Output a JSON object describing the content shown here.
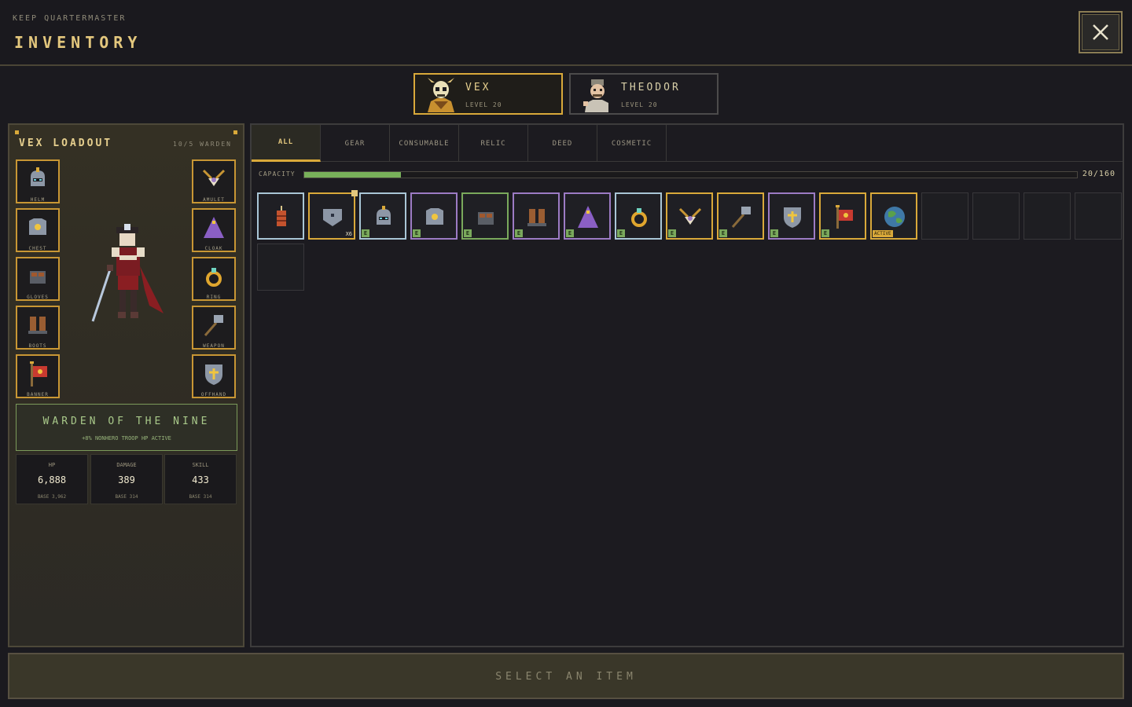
{
  "header": {
    "kicker": "KEEP QUARTERMASTER",
    "title": "INVENTORY",
    "close_icon": "close-icon"
  },
  "heroes": [
    {
      "name": "VEX",
      "level": "LEVEL 20",
      "active": true,
      "portrait": "skull-hero-portrait"
    },
    {
      "name": "THEODOR",
      "level": "LEVEL 20",
      "active": false,
      "portrait": "chef-hero-portrait"
    }
  ],
  "loadout": {
    "title": "VEX LOADOUT",
    "count": "10/5 WARDEN",
    "left_slots": [
      {
        "label": "HELM",
        "icon": "helm-icon"
      },
      {
        "label": "CHEST",
        "icon": "chest-armor-icon"
      },
      {
        "label": "GLOVES",
        "icon": "gloves-icon"
      },
      {
        "label": "BOOTS",
        "icon": "boots-icon"
      },
      {
        "label": "BANNER",
        "icon": "banner-icon"
      }
    ],
    "right_slots": [
      {
        "label": "AMULET",
        "icon": "amulet-icon"
      },
      {
        "label": "CLOAK",
        "icon": "cloak-icon"
      },
      {
        "label": "RING",
        "icon": "ring-icon"
      },
      {
        "label": "WEAPON",
        "icon": "hammer-icon"
      },
      {
        "label": "OFFHAND",
        "icon": "shield-icon"
      }
    ],
    "set": {
      "name": "WARDEN OF THE NINE",
      "bonus": "+8% NONHERO TROOP HP ACTIVE"
    },
    "stats": [
      {
        "label": "HP",
        "value": "6,888",
        "base": "BASE 3,962"
      },
      {
        "label": "DAMAGE",
        "value": "389",
        "base": "BASE 314"
      },
      {
        "label": "SKILL",
        "value": "433",
        "base": "BASE 314"
      }
    ]
  },
  "filters": [
    "ALL",
    "GEAR",
    "CONSUMABLE",
    "RELIC",
    "DEED",
    "COSMETIC"
  ],
  "active_filter": "ALL",
  "capacity": {
    "label": "CAPACITY",
    "used": 20,
    "max": 160,
    "text": "20/160"
  },
  "items": [
    {
      "icon": "dynamite-icon",
      "rarity": "#a9c6d6",
      "equipped": false
    },
    {
      "icon": "banner-token-icon",
      "rarity": "#d9a93a",
      "equipped": false,
      "quantity": "X6",
      "pinned": true
    },
    {
      "icon": "helm-icon",
      "rarity": "#a9c6d6",
      "equipped": true
    },
    {
      "icon": "chest-armor-icon",
      "rarity": "#9c7bc4",
      "equipped": true
    },
    {
      "icon": "gloves-icon",
      "rarity": "#7aa95c",
      "equipped": true
    },
    {
      "icon": "boots-icon",
      "rarity": "#9c7bc4",
      "equipped": true
    },
    {
      "icon": "cloak-icon",
      "rarity": "#9c7bc4",
      "equipped": true
    },
    {
      "icon": "ring-icon",
      "rarity": "#a9c6d6",
      "equipped": true
    },
    {
      "icon": "amulet-icon",
      "rarity": "#d9a93a",
      "equipped": true
    },
    {
      "icon": "hammer-icon",
      "rarity": "#d9a93a",
      "equipped": true
    },
    {
      "icon": "shield-icon",
      "rarity": "#9c7bc4",
      "equipped": true
    },
    {
      "icon": "banner-icon",
      "rarity": "#d9a93a",
      "equipped": true
    },
    {
      "icon": "globe-cosmetic-icon",
      "rarity": "#d9a93a",
      "equipped": false,
      "active": "ACTIVE"
    }
  ],
  "empty_slots": 5,
  "footer": {
    "prompt": "SELECT AN ITEM"
  },
  "colors": {
    "gold": "#d9a93a",
    "green": "#7aa95c",
    "purple": "#9c7bc4",
    "blue": "#a9c6d6"
  }
}
